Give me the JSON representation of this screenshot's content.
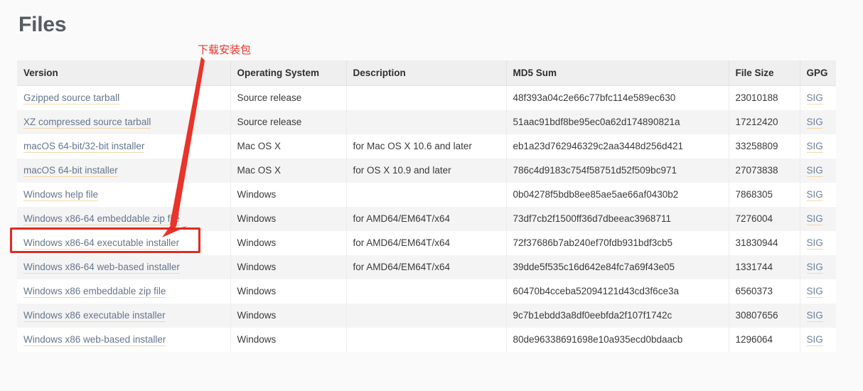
{
  "page": {
    "title": "Files",
    "background_color": "#fafafa"
  },
  "table": {
    "name": "files-table",
    "columns": [
      "Version",
      "Operating System",
      "Description",
      "MD5 Sum",
      "File Size",
      "GPG"
    ],
    "rows": [
      {
        "version": "Gzipped source tarball",
        "os": "Source release",
        "description": "",
        "md5": "48f393a04c2e66c77bfc114e589ec630",
        "size": "23010188",
        "gpg": "SIG"
      },
      {
        "version": "XZ compressed source tarball",
        "os": "Source release",
        "description": "",
        "md5": "51aac91bdf8be95ec0a62d174890821a",
        "size": "17212420",
        "gpg": "SIG"
      },
      {
        "version": "macOS 64-bit/32-bit installer",
        "os": "Mac OS X",
        "description": "for Mac OS X 10.6 and later",
        "md5": "eb1a23d762946329c2aa3448d256d421",
        "size": "33258809",
        "gpg": "SIG"
      },
      {
        "version": "macOS 64-bit installer",
        "os": "Mac OS X",
        "description": "for OS X 10.9 and later",
        "md5": "786c4d9183c754f58751d52f509bc971",
        "size": "27073838",
        "gpg": "SIG"
      },
      {
        "version": "Windows help file",
        "os": "Windows",
        "description": "",
        "md5": "0b04278f5bdb8ee85ae5ae66af0430b2",
        "size": "7868305",
        "gpg": "SIG"
      },
      {
        "version": "Windows x86-64 embeddable zip file",
        "os": "Windows",
        "description": "for AMD64/EM64T/x64",
        "md5": "73df7cb2f1500ff36d7dbeeac3968711",
        "size": "7276004",
        "gpg": "SIG"
      },
      {
        "version": "Windows x86-64 executable installer",
        "os": "Windows",
        "description": "for AMD64/EM64T/x64",
        "md5": "72f37686b7ab240ef70fdb931bdf3cb5",
        "size": "31830944",
        "gpg": "SIG"
      },
      {
        "version": "Windows x86-64 web-based installer",
        "os": "Windows",
        "description": "for AMD64/EM64T/x64",
        "md5": "39dde5f535c16d642e84fc7a69f43e05",
        "size": "1331744",
        "gpg": "SIG"
      },
      {
        "version": "Windows x86 embeddable zip file",
        "os": "Windows",
        "description": "",
        "md5": "60470b4cceba52094121d43cd3f6ce3a",
        "size": "6560373",
        "gpg": "SIG"
      },
      {
        "version": "Windows x86 executable installer",
        "os": "Windows",
        "description": "",
        "md5": "9c7b1ebdd3a8df0eebfda2f107f1742c",
        "size": "30807656",
        "gpg": "SIG"
      },
      {
        "version": "Windows x86 web-based installer",
        "os": "Windows",
        "description": "",
        "md5": "80de96338691698e10a935ecd0bdaacb",
        "size": "1296064",
        "gpg": "SIG"
      }
    ]
  },
  "annotation": {
    "label": "下载安装包",
    "color": "#e8342a",
    "highlight_target": "Windows x86-64 executable installer",
    "arrow_color": "#e02b20"
  }
}
